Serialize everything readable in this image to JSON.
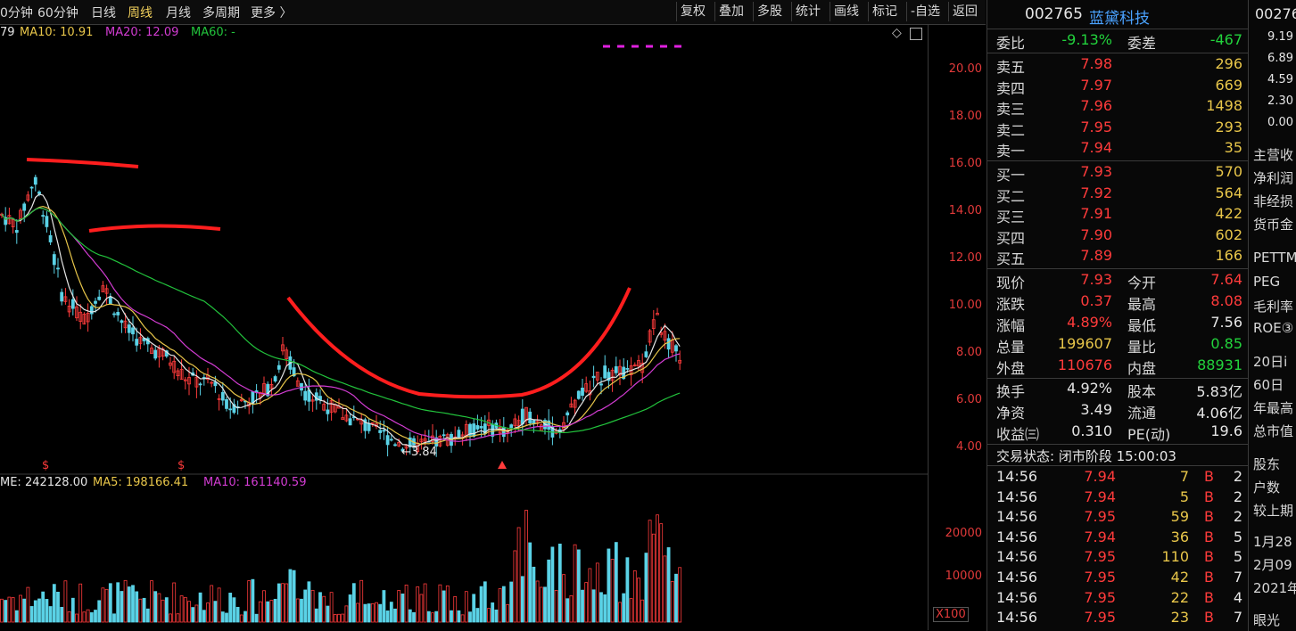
{
  "toolbar": {
    "periods": [
      "0分钟",
      "60分钟",
      "日线",
      "周线",
      "月线",
      "多周期",
      "更多 〉"
    ],
    "active_period": "周线",
    "buttons": [
      "复权",
      "叠加",
      "多股",
      "统计",
      "画线",
      "标记",
      "-自选",
      "返回"
    ]
  },
  "main_chart": {
    "ma_legend": [
      {
        "label": "79",
        "color": "#e6e6e6"
      },
      {
        "label": "MA10: 10.91",
        "color": "#e8c64a"
      },
      {
        "label": "MA20: 12.09",
        "color": "#d23cd2"
      },
      {
        "label": "MA60: -",
        "color": "#22c33c"
      }
    ],
    "price_axis": [
      "20.00",
      "18.00",
      "16.00",
      "14.00",
      "12.00",
      "10.00",
      "8.00",
      "6.00",
      "4.00"
    ],
    "low_marker": "←3.84",
    "event_marks": [
      "$",
      "$"
    ],
    "colors": {
      "up": "#ff3b3b",
      "down": "#5ad2e6",
      "ma5": "#e6e6e6",
      "ma10": "#e8c64a",
      "ma20": "#d23cd2",
      "ma60": "#22c33c",
      "drawing": "#ff1e1e"
    }
  },
  "volume_chart": {
    "legend": [
      {
        "label": "ME: 242128.00",
        "color": "#e6e6e6"
      },
      {
        "label": "MA5: 198166.41",
        "color": "#e8c64a"
      },
      {
        "label": "MA10: 161140.59",
        "color": "#d23cd2"
      }
    ],
    "axis": [
      "20000",
      "10000"
    ],
    "unit": "X100"
  },
  "quote": {
    "code": "002765",
    "name": "蓝黛科技",
    "webi_label": "委比",
    "webi": "-9.13%",
    "weicha_label": "委差",
    "weicha": "-467",
    "asks": [
      {
        "label": "卖五",
        "price": "7.98",
        "vol": "296"
      },
      {
        "label": "卖四",
        "price": "7.97",
        "vol": "669"
      },
      {
        "label": "卖三",
        "price": "7.96",
        "vol": "1498"
      },
      {
        "label": "卖二",
        "price": "7.95",
        "vol": "293"
      },
      {
        "label": "卖一",
        "price": "7.94",
        "vol": "35"
      }
    ],
    "bids": [
      {
        "label": "买一",
        "price": "7.93",
        "vol": "570"
      },
      {
        "label": "买二",
        "price": "7.92",
        "vol": "564"
      },
      {
        "label": "买三",
        "price": "7.91",
        "vol": "422"
      },
      {
        "label": "买四",
        "price": "7.90",
        "vol": "602"
      },
      {
        "label": "买五",
        "price": "7.89",
        "vol": "166"
      }
    ],
    "stats": [
      {
        "l1": "现价",
        "v1": "7.93",
        "c1": "red",
        "l2": "今开",
        "v2": "7.64",
        "c2": "red"
      },
      {
        "l1": "涨跌",
        "v1": "0.37",
        "c1": "red",
        "l2": "最高",
        "v2": "8.08",
        "c2": "red"
      },
      {
        "l1": "涨幅",
        "v1": "4.89%",
        "c1": "red",
        "l2": "最低",
        "v2": "7.56",
        "c2": "wht"
      },
      {
        "l1": "总量",
        "v1": "199607",
        "c1": "ylw",
        "l2": "量比",
        "v2": "0.85",
        "c2": "grn"
      },
      {
        "l1": "外盘",
        "v1": "110676",
        "c1": "red",
        "l2": "内盘",
        "v2": "88931",
        "c2": "grn"
      }
    ],
    "stats2": [
      {
        "l1": "换手",
        "v1": "4.92%",
        "l2": "股本",
        "v2": "5.83亿"
      },
      {
        "l1": "净资",
        "v1": "3.49",
        "l2": "流通",
        "v2": "4.06亿"
      },
      {
        "l1": "收益㈢",
        "v1": "0.310",
        "l2": "PE(动)",
        "v2": "19.6"
      }
    ],
    "status": "交易状态: 闭市阶段 15:00:03",
    "ticks": [
      {
        "t": "14:56",
        "p": "7.94",
        "v": "7",
        "s": "B",
        "n": "2"
      },
      {
        "t": "14:56",
        "p": "7.94",
        "v": "5",
        "s": "B",
        "n": "2"
      },
      {
        "t": "14:56",
        "p": "7.95",
        "v": "59",
        "s": "B",
        "n": "2"
      },
      {
        "t": "14:56",
        "p": "7.94",
        "v": "36",
        "s": "B",
        "n": "5"
      },
      {
        "t": "14:56",
        "p": "7.95",
        "v": "110",
        "s": "B",
        "n": "5"
      },
      {
        "t": "14:56",
        "p": "7.95",
        "v": "42",
        "s": "B",
        "n": "7"
      },
      {
        "t": "14:56",
        "p": "7.95",
        "v": "22",
        "s": "B",
        "n": "4"
      },
      {
        "t": "14:56",
        "p": "7.95",
        "v": "23",
        "s": "B",
        "n": "7"
      }
    ]
  },
  "side": {
    "code": "00276",
    "nums": [
      "9.19",
      "6.89",
      "4.59",
      "2.30",
      "0.00"
    ],
    "items": [
      "主营收",
      "净利润",
      "非经损",
      "货币金",
      "PETTM",
      "PEG",
      "毛利率",
      "ROE③",
      "20日i",
      "60日",
      "年最高",
      "总市值",
      "股东",
      "户数",
      "较上期",
      "1月28",
      "2月09",
      "2021年",
      "眼光"
    ]
  }
}
